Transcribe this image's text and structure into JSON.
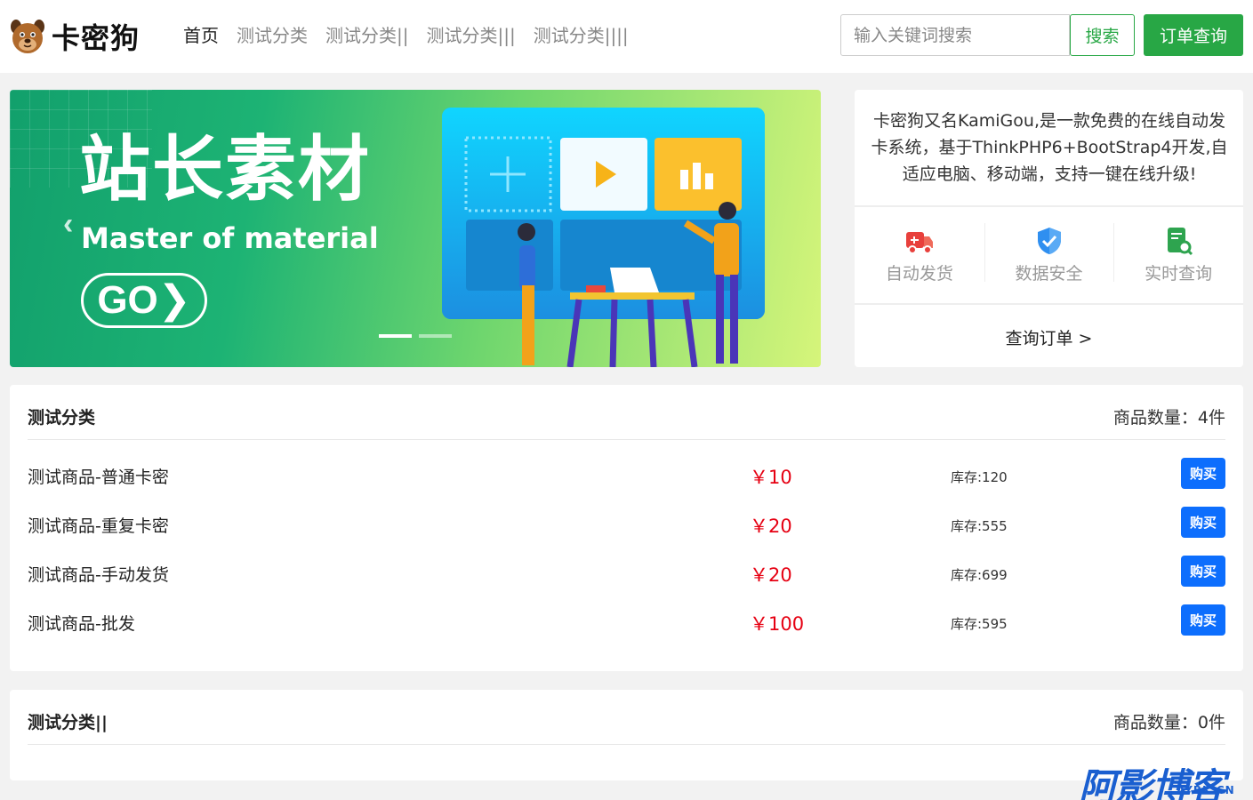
{
  "header": {
    "logo_text": "卡密狗",
    "nav": [
      "首页",
      "测试分类",
      "测试分类||",
      "测试分类|||",
      "测试分类||||"
    ],
    "search_placeholder": "输入关键词搜索",
    "search_button": "搜索",
    "order_button": "订单查询"
  },
  "banner": {
    "title": "站长素材",
    "subtitle": "Master of material",
    "go_label": "GO❯",
    "prev_arrow": "‹",
    "next_arrow": "›",
    "slides": 2,
    "active_slide": 1
  },
  "side": {
    "description": "卡密狗又名KamiGou,是一款免费的在线自动发卡系统，基于ThinkPHP6+BootStrap4开发,自适应电脑、移动端，支持一键在线升级!",
    "features": [
      {
        "label": "自动发货",
        "icon": "truck-icon",
        "color": "#e8403c"
      },
      {
        "label": "数据安全",
        "icon": "shield-icon",
        "color": "#2f8ff0"
      },
      {
        "label": "实时查询",
        "icon": "search-doc-icon",
        "color": "#2ea44f"
      }
    ],
    "query_link": "查询订单 >"
  },
  "categories": [
    {
      "title": "测试分类",
      "count": "商品数量：4件",
      "products": [
        {
          "name": "测试商品-普通卡密",
          "price": "￥10",
          "stock": "库存:120",
          "buy": "购买"
        },
        {
          "name": "测试商品-重复卡密",
          "price": "￥20",
          "stock": "库存:555",
          "buy": "购买"
        },
        {
          "name": "测试商品-手动发货",
          "price": "￥20",
          "stock": "库存:699",
          "buy": "购买"
        },
        {
          "name": "测试商品-批发",
          "price": "￥100",
          "stock": "库存:595",
          "buy": "购买"
        }
      ]
    },
    {
      "title": "测试分类||",
      "count": "商品数量：0件",
      "products": []
    }
  ],
  "watermark": {
    "text": "阿影博客",
    "sub": "AYBK.CN"
  },
  "colors": {
    "green": "#28a745",
    "blue": "#0d6efd",
    "price_red": "#e60012"
  }
}
